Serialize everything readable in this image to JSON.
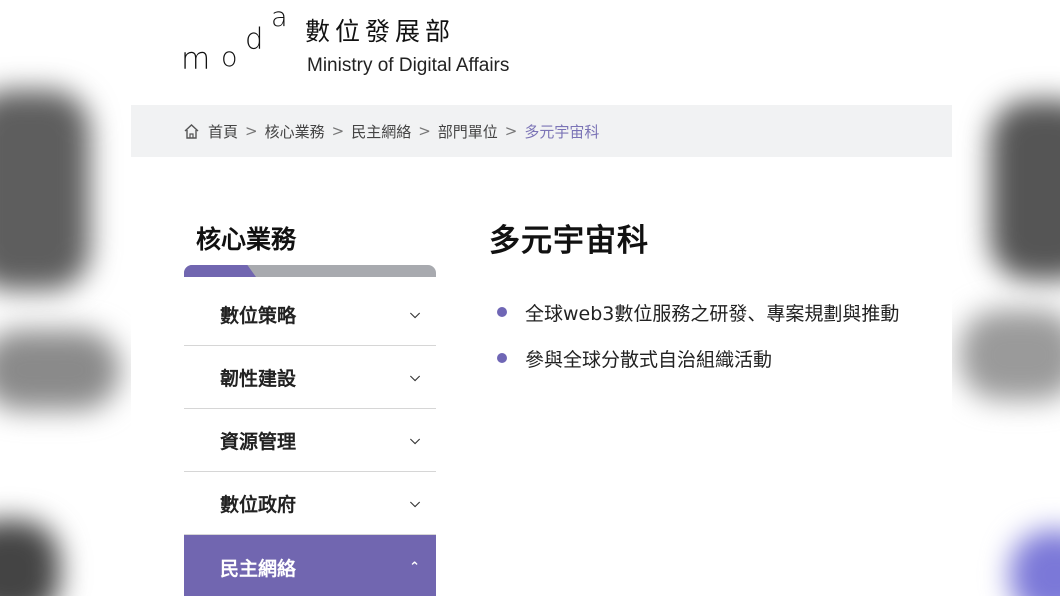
{
  "header": {
    "logo_letters": [
      "m",
      "o",
      "d",
      "a"
    ],
    "site_name_zh": "數位發展部",
    "site_name_en": "Ministry of Digital Affairs"
  },
  "breadcrumb": {
    "home_icon": "home-icon",
    "items": [
      "首頁",
      "核心業務",
      "民主網絡",
      "部門單位",
      "多元宇宙科"
    ],
    "separator": ">"
  },
  "sidebar": {
    "title": "核心業務",
    "items": [
      {
        "label": "數位策略",
        "icon": "chevron-down"
      },
      {
        "label": "韌性建設",
        "icon": "chevron-down"
      },
      {
        "label": "資源管理",
        "icon": "chevron-down"
      },
      {
        "label": "數位政府",
        "icon": "chevron-down"
      },
      {
        "label": "民主網絡",
        "icon": "chevron-up",
        "active": true
      }
    ]
  },
  "main": {
    "title": "多元宇宙科",
    "bullets": [
      "全球web3數位服務之研發、專案規劃與推動",
      "參與全球分散式自治組織活動"
    ]
  },
  "colors": {
    "accent": "#7166b0",
    "breadcrumb_bg": "#f1f2f3",
    "current_crumb": "#7b74b6"
  }
}
